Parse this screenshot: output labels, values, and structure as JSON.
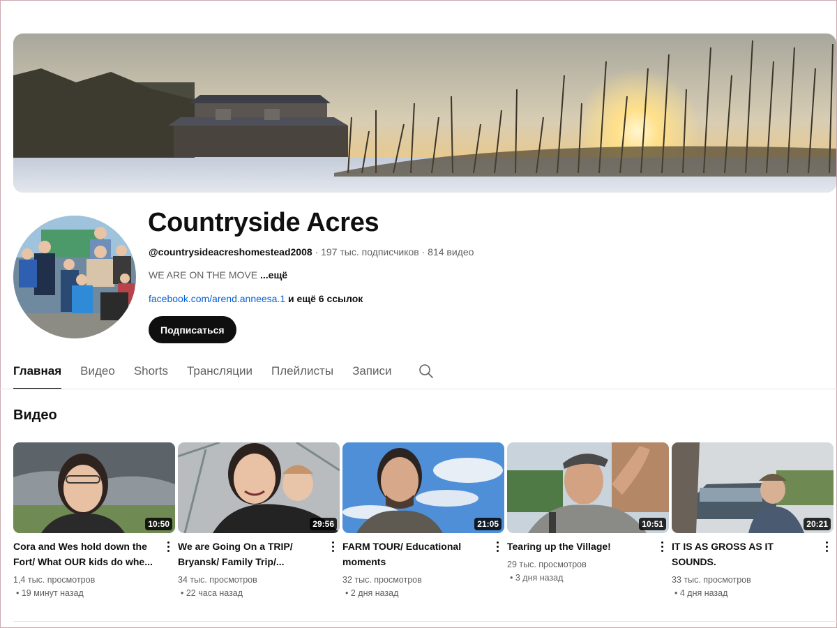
{
  "channel": {
    "name": "Countryside Acres",
    "handle": "@countrysideacreshomestead2008",
    "subscribers": "197 тыс. подписчиков",
    "video_count": "814 видео",
    "separator": " · ",
    "description": "WE ARE ON THE MOVE",
    "description_more": "...ещё",
    "link": "facebook.com/arend.anneesa.1",
    "more_links": "и ещё 6 ссылок",
    "subscribe_label": "Подписаться"
  },
  "tabs": [
    {
      "label": "Главная",
      "active": true
    },
    {
      "label": "Видео",
      "active": false
    },
    {
      "label": "Shorts",
      "active": false
    },
    {
      "label": "Трансляции",
      "active": false
    },
    {
      "label": "Плейлисты",
      "active": false
    },
    {
      "label": "Записи",
      "active": false
    }
  ],
  "tabs_search_icon": "search-icon",
  "section_title": "Видео",
  "videos": [
    {
      "title": "Cora and Wes hold down the Fort/ What OUR kids do whe...",
      "duration": "10:50",
      "views": "1,4 тыс. просмотров",
      "age": "• 19 минут назад"
    },
    {
      "title": "We are Going On a TRIP/ Bryansk/ Family Trip/...",
      "duration": "29:56",
      "views": "34 тыс. просмотров",
      "age": "• 22 часа назад"
    },
    {
      "title": "FARM TOUR/ Educational moments",
      "duration": "21:05",
      "views": "32 тыс. просмотров",
      "age": "• 2 дня назад"
    },
    {
      "title": "Tearing up the Village!",
      "duration": "10:51",
      "views": "29 тыс. просмотров",
      "age": "• 3 дня назад"
    },
    {
      "title": "IT IS AS GROSS AS IT SOUNDS.",
      "duration": "20:21",
      "views": "33 тыс. просмотров",
      "age": "• 4 дня назад"
    }
  ],
  "colors": {
    "text_primary": "#0f0f0f",
    "text_secondary": "#606060",
    "link": "#065fd4",
    "button_bg": "#0f0f0f"
  }
}
